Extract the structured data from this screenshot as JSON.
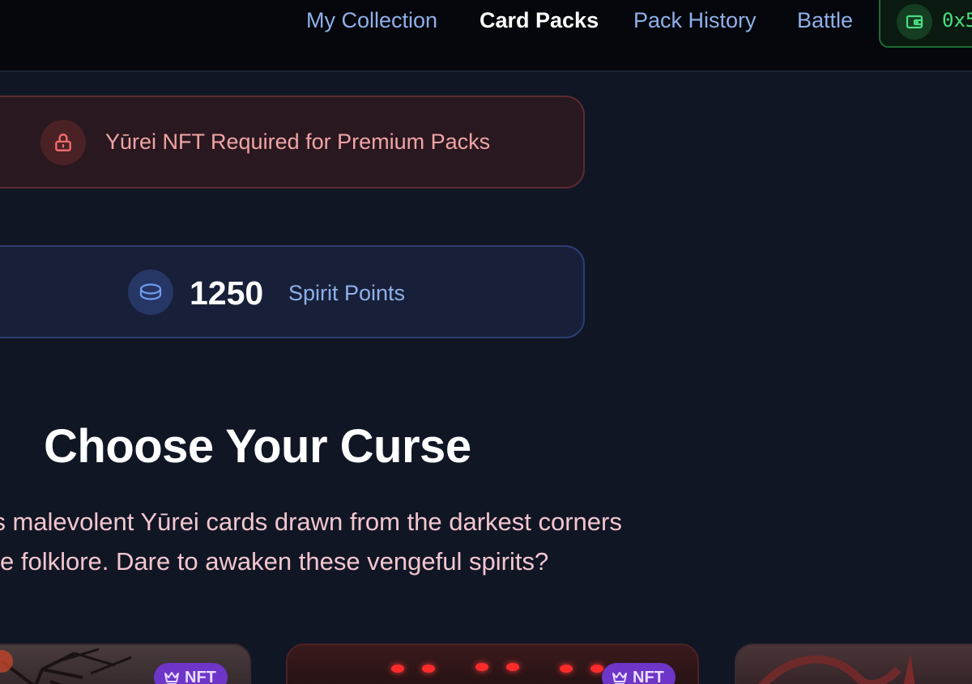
{
  "nav": {
    "links": [
      {
        "label": "My Collection",
        "active": false
      },
      {
        "label": "Card Packs",
        "active": true
      },
      {
        "label": "Pack History",
        "active": false
      },
      {
        "label": "Battle",
        "active": false
      }
    ],
    "wallet": {
      "address": "0x5",
      "icon": "wallet-icon"
    }
  },
  "lock_banner": {
    "icon": "lock-icon",
    "text": "Yūrei NFT Required for Premium Packs"
  },
  "points": {
    "icon": "coins-icon",
    "value": "1250",
    "label": "Spirit Points"
  },
  "section": {
    "title": "Choose Your Curse",
    "description_lines": [
      "ains malevolent Yūrei cards drawn from the darkest corners",
      "nese folklore. Dare to awaken these vengeful spirits?"
    ]
  },
  "cards": [
    {
      "badge": "NFT",
      "badge_icon": "crown-icon"
    },
    {
      "badge": "NFT",
      "badge_icon": "crown-icon"
    },
    {
      "badge": ""
    }
  ],
  "colors": {
    "background": "#111624",
    "nav_link": "#8fb0ea",
    "wallet_green": "#4ade80",
    "lock_red": "#f0a5a5",
    "nft_purple": "#6d35c8"
  }
}
